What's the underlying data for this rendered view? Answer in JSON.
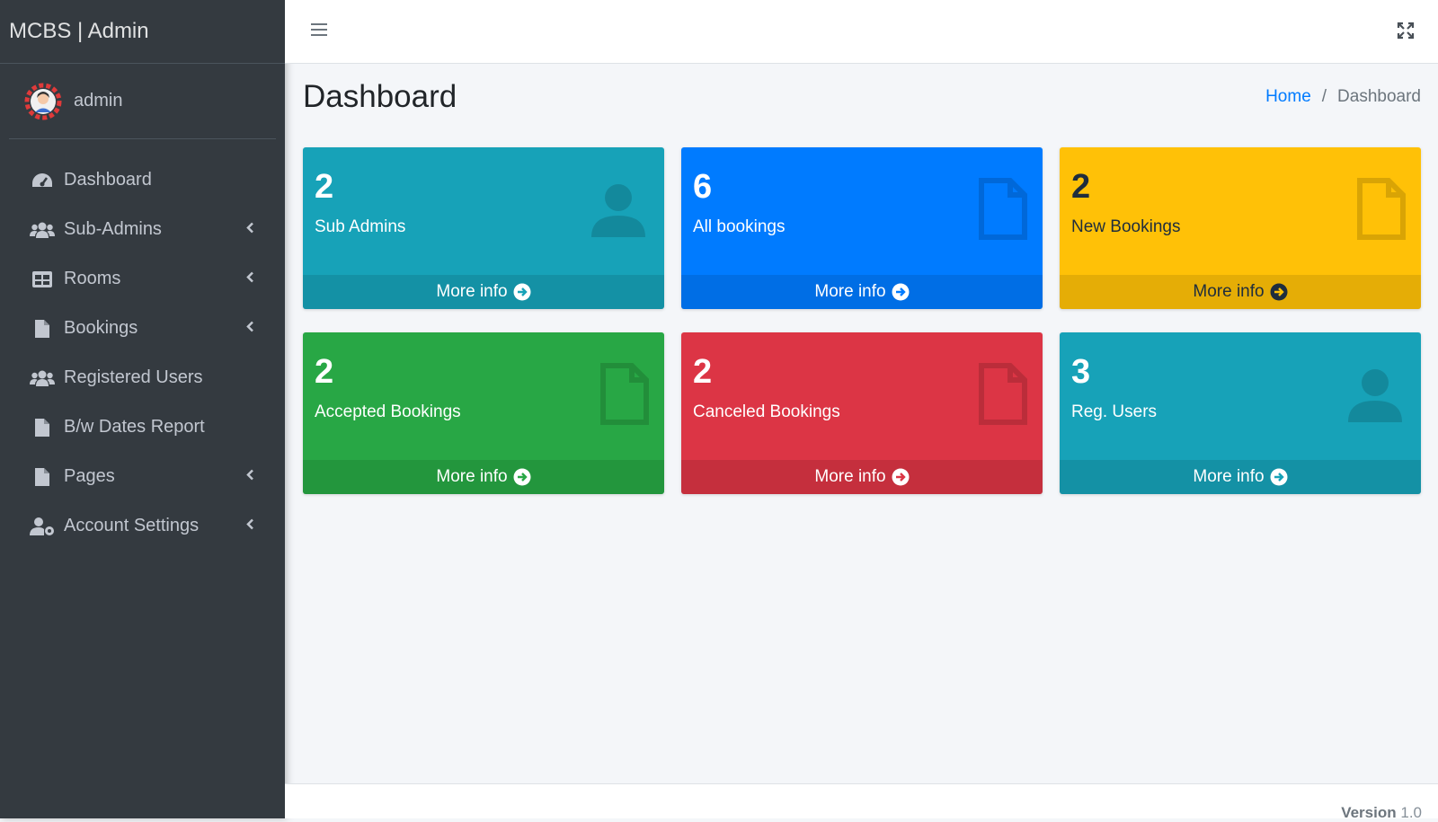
{
  "sidebar": {
    "brand": "MCBS | Admin",
    "user": "admin",
    "items": [
      {
        "label": "Dashboard",
        "icon": "dashboard-icon",
        "arrow": false
      },
      {
        "label": "Sub-Admins",
        "icon": "users-icon",
        "arrow": true
      },
      {
        "label": "Rooms",
        "icon": "table-icon",
        "arrow": true
      },
      {
        "label": "Bookings",
        "icon": "file-icon",
        "arrow": true
      },
      {
        "label": "Registered Users",
        "icon": "users-icon",
        "arrow": false
      },
      {
        "label": "B/w Dates Report",
        "icon": "file-icon",
        "arrow": false
      },
      {
        "label": "Pages",
        "icon": "file-icon",
        "arrow": true
      },
      {
        "label": "Account Settings",
        "icon": "user-cog-icon",
        "arrow": true
      }
    ]
  },
  "header": {
    "title": "Dashboard",
    "breadcrumb": {
      "home": "Home",
      "separator": "/",
      "current": "Dashboard"
    }
  },
  "boxes": [
    {
      "count": "2",
      "label": "Sub Admins",
      "more": "More info",
      "color": "#17a2b8",
      "icon": "user-icon"
    },
    {
      "count": "6",
      "label": "All bookings",
      "more": "More info",
      "color": "#007bff",
      "icon": "file-icon"
    },
    {
      "count": "2",
      "label": "New Bookings",
      "more": "More info",
      "color": "#ffc107",
      "icon": "file-icon"
    },
    {
      "count": "2",
      "label": "Accepted Bookings",
      "more": "More info",
      "color": "#28a745",
      "icon": "file-icon"
    },
    {
      "count": "2",
      "label": "Canceled Bookings",
      "more": "More info",
      "color": "#dc3545",
      "icon": "file-icon"
    },
    {
      "count": "3",
      "label": "Reg. Users",
      "more": "More info",
      "color": "#17a2b8",
      "icon": "user-icon"
    }
  ],
  "footer": {
    "version_label": "Version",
    "version": "1.0"
  }
}
